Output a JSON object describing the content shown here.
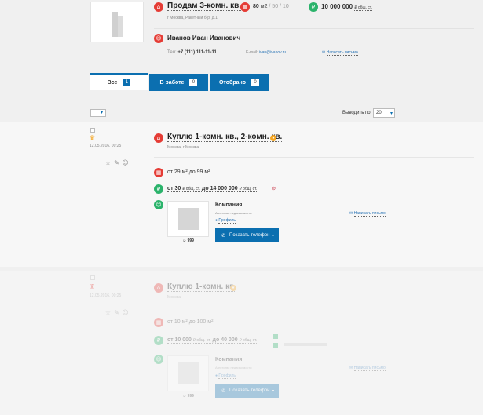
{
  "top": {
    "title": "Продам 3-комн. кв.",
    "address": "г Москва, Ракетный б-р, д.1",
    "area_value": "80",
    "area_unit": "м2",
    "area_rest": "/ 50 / 10",
    "price": "10 000 000",
    "price_unit": "₽ общ. ст.",
    "owner": "Иванов Иван Иванович",
    "phone_label": "Тел:",
    "phone": "+7 (111) 111-11-11",
    "email_label": "E-mail:",
    "email": "ivan@ivanov.ru",
    "write_letter": "Написать письмо"
  },
  "tabs": [
    {
      "label": "Все",
      "count": "1"
    },
    {
      "label": "В работе",
      "count": "0"
    },
    {
      "label": "Отобрано",
      "count": "0"
    }
  ],
  "toolbar": {
    "show_by_label": "Выводить по:",
    "show_by_value": "20"
  },
  "request1": {
    "date": "12.05.2016, 00:25",
    "title": "Куплю 1-комн. кв., 2-комн. кв.",
    "location": "Москва, г Москва",
    "area": "от 29 м² до 99 м²",
    "price_from": "от 30",
    "price_unit_a": "₽ общ. ст.",
    "price_to": "до 14 000 000",
    "price_unit_b": "₽ общ. ст.",
    "company": "Компания",
    "agency": "Агентство недвижимости",
    "profile": "Профиль",
    "show_phone": "Показать телефон",
    "write_letter": "Написать письмо",
    "rating": "999"
  },
  "request2": {
    "date": "12.05.2016, 00:25",
    "title": "Куплю 1-комн. кв.",
    "location": "Москва",
    "area": "от 10 м² до 100 м²",
    "price_from": "от 10 000",
    "price_unit_a": "₽ общ. ст.",
    "price_to": "до 40 000",
    "price_unit_b": "₽ общ. ст.",
    "company": "Компания",
    "agency": "Агентство недвижимости",
    "profile": "Профиль",
    "show_phone": "Показать телефон",
    "write_letter": "Написать письмо",
    "rating": "999"
  },
  "colors": {
    "accent_blue": "#0b6fb0",
    "red": "#e53c35",
    "green": "#2bb36b",
    "orange": "#f5a623"
  }
}
